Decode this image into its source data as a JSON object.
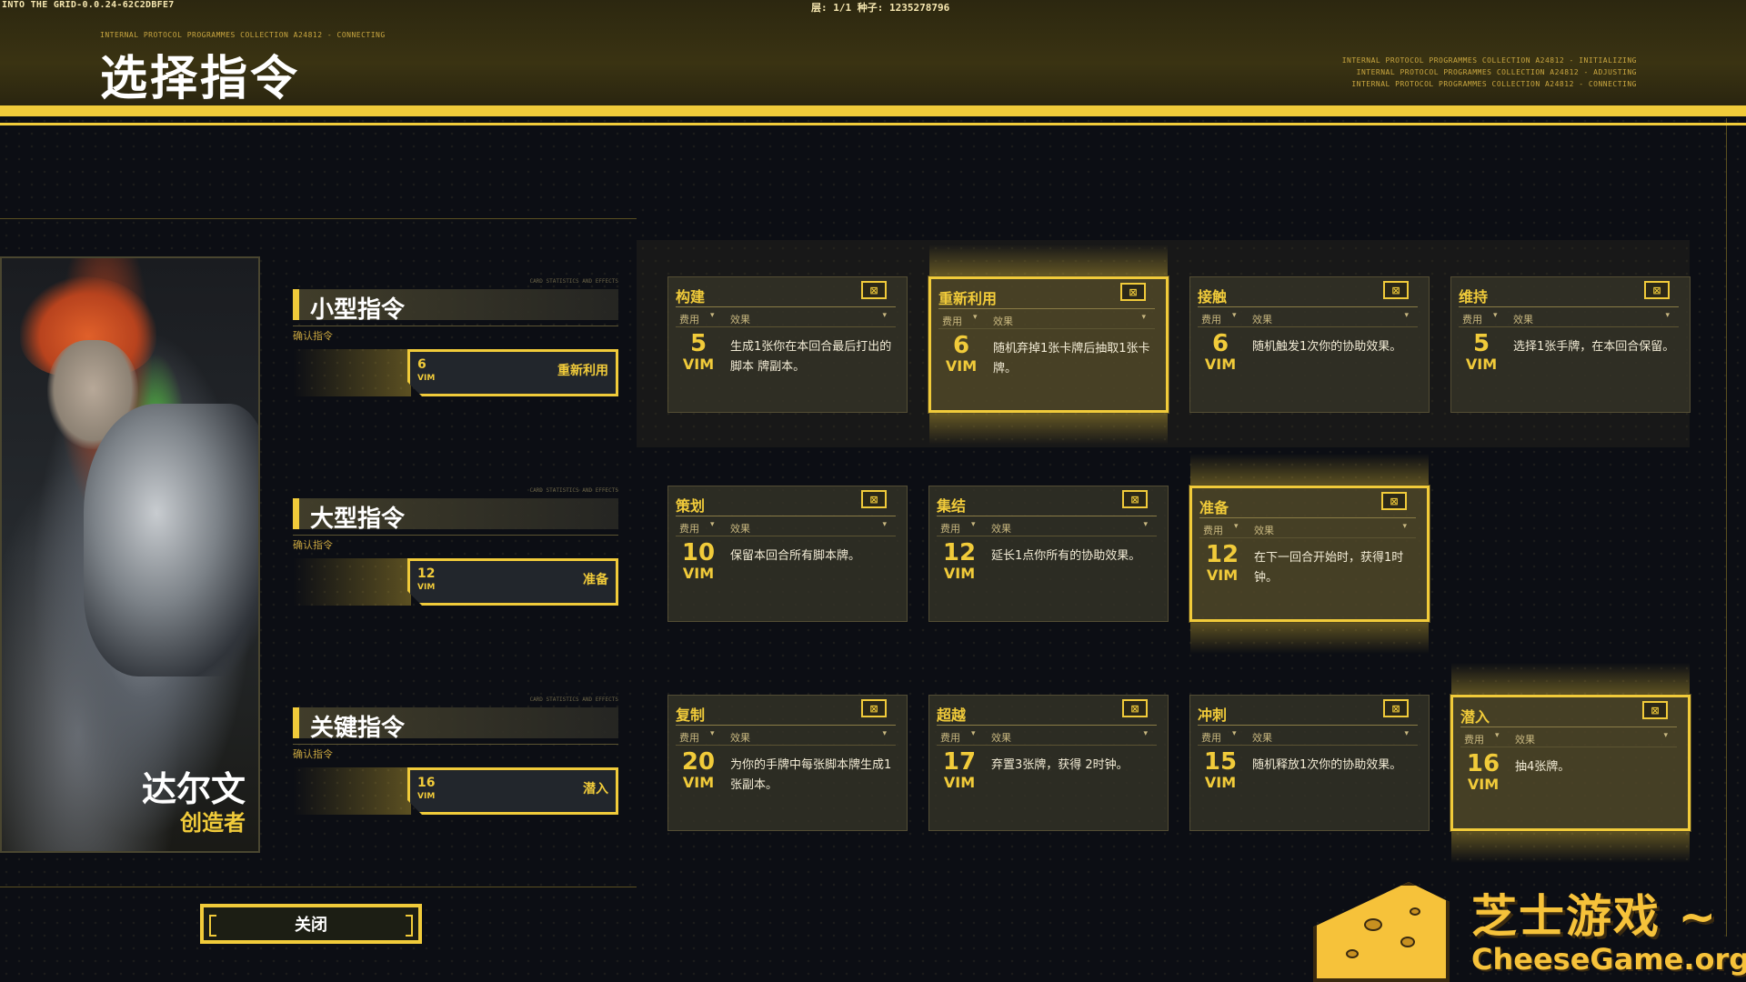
{
  "header": {
    "build": "INTO THE GRID-0.0.24-62C2DBFE7",
    "seed_info": "层: 1/1 种子: 1235278796",
    "protocol_small": "INTERNAL PROTOCOL PROGRAMMES COLLECTION A24812 - CONNECTING",
    "title": "选择指令",
    "protocol_lines": [
      "INTERNAL PROTOCOL PROGRAMMES COLLECTION A24812 - INITIALIZING",
      "INTERNAL PROTOCOL PROGRAMMES COLLECTION A24812 - ADJUSTING",
      "INTERNAL PROTOCOL PROGRAMMES COLLECTION A24812 - CONNECTING"
    ]
  },
  "character": {
    "name": "达尔文",
    "role": "创造者"
  },
  "categories": [
    {
      "meta": "CARD STATISTICS AND EFFECTS",
      "title": "小型指令",
      "sub": "确认指令",
      "slot_cost": "6",
      "slot_unit": "VIM",
      "slot_name": "重新利用"
    },
    {
      "meta": "CARD STATISTICS AND EFFECTS",
      "title": "大型指令",
      "sub": "确认指令",
      "slot_cost": "12",
      "slot_unit": "VIM",
      "slot_name": "准备"
    },
    {
      "meta": "CARD STATISTICS AND EFFECTS",
      "title": "关键指令",
      "sub": "确认指令",
      "slot_cost": "16",
      "slot_unit": "VIM",
      "slot_name": "潜入"
    }
  ],
  "card_labels": {
    "cost_header": "费用",
    "effect_header": "效果",
    "unit": "VIM",
    "caret": "▾",
    "icon_glyph": "⊠"
  },
  "cards": [
    [
      {
        "name": "构建",
        "cost": "5",
        "effect": "生成1张你在本回合最后打出的脚本 牌副本。",
        "selected": false
      },
      {
        "name": "重新利用",
        "cost": "6",
        "effect": "随机弃掉1张卡牌后抽取1张卡牌。",
        "selected": true
      },
      {
        "name": "接触",
        "cost": "6",
        "effect": "随机触发1次你的协助效果。",
        "selected": false
      },
      {
        "name": "维持",
        "cost": "5",
        "effect": "选择1张手牌，在本回合保留。",
        "selected": false
      }
    ],
    [
      {
        "name": "策划",
        "cost": "10",
        "effect": "保留本回合所有脚本牌。",
        "selected": false
      },
      {
        "name": "集结",
        "cost": "12",
        "effect": "延长1点你所有的协助效果。",
        "selected": false
      },
      {
        "name": "准备",
        "cost": "12",
        "effect": "在下一回合开始时，获得1时钟。",
        "selected": true
      }
    ],
    [
      {
        "name": "复制",
        "cost": "20",
        "effect": "为你的手牌中每张脚本牌生成1张副本。",
        "selected": false
      },
      {
        "name": "超越",
        "cost": "17",
        "effect": "弃置3张牌，获得 2时钟。",
        "selected": false
      },
      {
        "name": "冲刺",
        "cost": "15",
        "effect": "随机释放1次你的协助效果。",
        "selected": false
      },
      {
        "name": "潜入",
        "cost": "16",
        "effect": "抽4张牌。",
        "selected": true
      }
    ]
  ],
  "footer": {
    "close_label": "关闭"
  },
  "watermark": {
    "cn": "芝士游戏 ~",
    "en": "CheeseGame.org"
  },
  "colors": {
    "accent": "#f1cb3a",
    "background": "#0c0e14"
  }
}
